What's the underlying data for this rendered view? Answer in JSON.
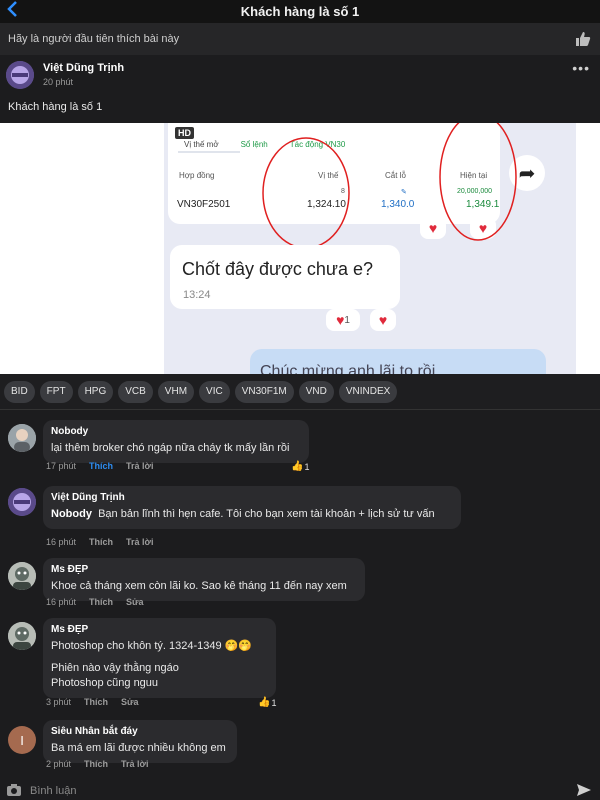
{
  "header": {
    "title": "Khách hàng là số 1",
    "back_icon": "chevron-left-icon"
  },
  "likebar": {
    "text": "Hãy là người đầu tiên thích bài này",
    "icon": "thumbs-up-icon"
  },
  "post": {
    "author": "Việt Dũng Trịnh",
    "time": "20 phút",
    "text": "Khách hàng là số 1",
    "more_icon": "more-icon"
  },
  "image": {
    "hd_badge": "HD",
    "tabs": [
      "Vị thế mở",
      "Sổ lệnh",
      "Tác động VN30"
    ],
    "columns": [
      "Hợp đồng",
      "Vị thế",
      "Cắt lỗ",
      "Hiện tại"
    ],
    "row": {
      "contract": "VN30F2501",
      "position_small": "8",
      "position": "1,324.10",
      "stoploss": "1,340.0",
      "current_small": "20,000,000",
      "current": "1,349.1"
    },
    "message": "Chốt đây được chưa e?",
    "message_time": "13:24",
    "reaction_count": "1",
    "partial_message": "Chúc mừng anh lãi to rồi"
  },
  "tags": [
    "BID",
    "FPT",
    "HPG",
    "VCB",
    "VHM",
    "VIC",
    "VN30F1M",
    "VND",
    "VNINDEX"
  ],
  "comments": [
    {
      "name": "Nobody",
      "text": "lại thêm broker chó ngáp nữa cháy tk mấy lần rồi",
      "time": "17 phút",
      "like": "Thích",
      "reply": "Trả lời",
      "likes": "1"
    },
    {
      "name": "Việt Dũng Trịnh",
      "mention": "Nobody",
      "text": "Bạn bản lĩnh thì hẹn cafe. Tôi cho bạn xem tài khoản + lịch sử tư vấn",
      "time": "16 phút",
      "like": "Thích",
      "reply": "Trả lời"
    },
    {
      "name": "Ms ĐẸP",
      "text": "Khoe cả tháng xem còn lãi ko. Sao kê tháng 11 đến nay xem",
      "time": "16 phút",
      "like": "Thích",
      "reply": "Sửa"
    },
    {
      "name": "Ms ĐẸP",
      "line1": "Photoshop cho khôn tý. 1324-1349 🤭🤭",
      "line2": "Phiên nào vậy thằng ngáo",
      "line3": "Photoshop cũng nguu",
      "time": "3 phút",
      "like": "Thích",
      "reply": "Sửa",
      "likes": "1"
    },
    {
      "name": "Siêu Nhân bắt đáy",
      "text": "Ba má em lãi được nhiều không em",
      "time": "2 phút",
      "like": "Thích",
      "reply": "Trả lời",
      "avatar_letter": "I"
    }
  ],
  "input": {
    "placeholder": "Bình luận",
    "camera_icon": "camera-icon",
    "send_icon": "send-icon"
  }
}
